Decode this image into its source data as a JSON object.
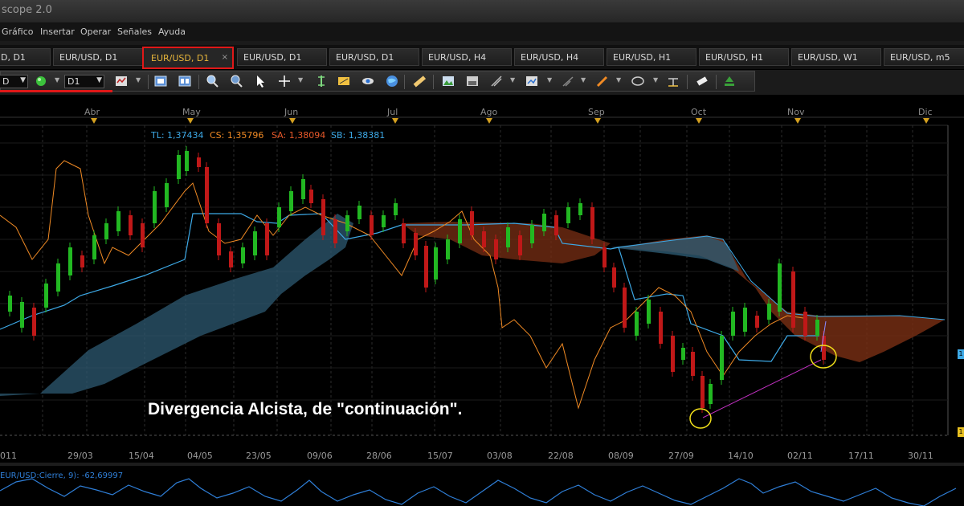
{
  "app": {
    "title": "scope 2.0"
  },
  "menu": [
    "Gráfico",
    "Insertar",
    "Operar",
    "Señales",
    "Ayuda"
  ],
  "tabs": [
    "D, D1",
    "EUR/USD, D1",
    "EUR/USD, D1",
    "EUR/USD, D1",
    "EUR/USD, D1",
    "EUR/USD, H4",
    "EUR/USD, H4",
    "EUR/USD, H1",
    "EUR/USD, H1",
    "EUR/USD, W1",
    "EUR/USD, m5"
  ],
  "active_tab_index": 2,
  "active_tab_close": "×",
  "toolbar": {
    "symbol_value": "D",
    "timeframe_value": "D1",
    "tools": [
      "bar-chart-type-icon",
      "new-window-icon",
      "template-icon",
      "zoom-in-icon",
      "zoom-out-icon",
      "cursor-icon",
      "crosshair-icon",
      "period-separator-icon",
      "text-label-icon",
      "eye-icon",
      "globe-icon",
      "ruler-icon",
      "picture-icon",
      "save-icon",
      "line-study-icon",
      "indicator-icon",
      "trendline-icon",
      "pencil-icon",
      "ellipse-icon",
      "text-icon",
      "eraser-icon",
      "tree-icon"
    ]
  },
  "chart": {
    "months": [
      "Abr",
      "May",
      "Jun",
      "Jul",
      "Ago",
      "Sep",
      "Oct",
      "Nov",
      "Dic"
    ],
    "dates": [
      "011",
      "29/03",
      "15/04",
      "04/05",
      "23/05",
      "09/06",
      "28/06",
      "15/07",
      "03/08",
      "22/08",
      "08/09",
      "27/09",
      "14/10",
      "02/11",
      "17/11",
      "30/11"
    ],
    "legend": [
      {
        "text": "TL: 1,37434",
        "color": "#3da9e6"
      },
      {
        "text": "CS: 1,35796",
        "color": "#f08a24"
      },
      {
        "text": "SA: 1,38094",
        "color": "#e8592a"
      },
      {
        "text": "SB: 1,38381",
        "color": "#3da9e6"
      }
    ],
    "annotation": "Divergencia Alcista, de \"continuación\".",
    "indicator_legend": "EUR/USD:Cierre, 9): -62,69997",
    "right_labels": [
      "1",
      "1"
    ],
    "colors": {
      "bull": "#22b822",
      "bear": "#c01818",
      "tenkan": "#3da9e6",
      "chikou": "#f08a24",
      "cloud_bull": "#2d5a72",
      "cloud_bear": "#7a2f14",
      "annotation_circle": "#f2e01a",
      "divergence_line": "#c030c0"
    }
  }
}
